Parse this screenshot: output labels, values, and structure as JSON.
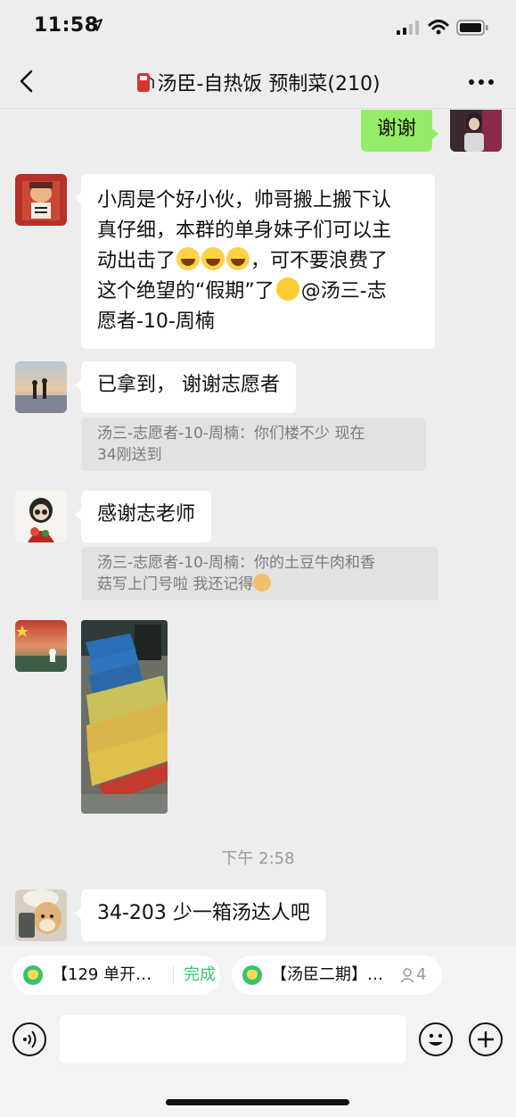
{
  "status_bar": {
    "time": "11:58"
  },
  "header": {
    "title": "汤臣-自热饭 预制菜(210)"
  },
  "messages": {
    "m1": {
      "text": "谢谢"
    },
    "m2": {
      "line1": "小周是个好小伙，帅哥搬上搬下认",
      "line2": "真仔细，本群的单身妹子们可以主",
      "line3a": "动出击了",
      "line3b": "，可不要浪费了",
      "line4a": "这个绝望的“假期”了",
      "line4b": "@汤三-志",
      "line5": "愿者-10-周楠"
    },
    "m3": {
      "text": "已拿到， 谢谢志愿者",
      "quote_line1": "汤三-志愿者-10-周楠：你们楼不少 现在",
      "quote_line2": "34刚送到"
    },
    "m4": {
      "text": "感谢志老师",
      "quote_line1": "汤三-志愿者-10-周楠：你的土豆牛肉和香",
      "quote_line2": "菇写上门号啦 我还记得"
    },
    "timestamp": "下午 2:58",
    "m6": {
      "text": "34-203 少一箱汤达人吧"
    }
  },
  "quick_bar": {
    "pill1_label": "【129 单开…",
    "pill1_status": "完成",
    "pill2_label": "【汤臣二期】…",
    "pill2_count": "4"
  },
  "input": {
    "placeholder": ""
  },
  "colors": {
    "bubble_green": "#95ec69",
    "background": "#ededed",
    "accent_green": "#39c46a"
  },
  "icons": [
    "back-icon",
    "fuel-icon",
    "more-icon",
    "voice-icon",
    "emoji-icon",
    "plus-icon",
    "person-icon"
  ]
}
